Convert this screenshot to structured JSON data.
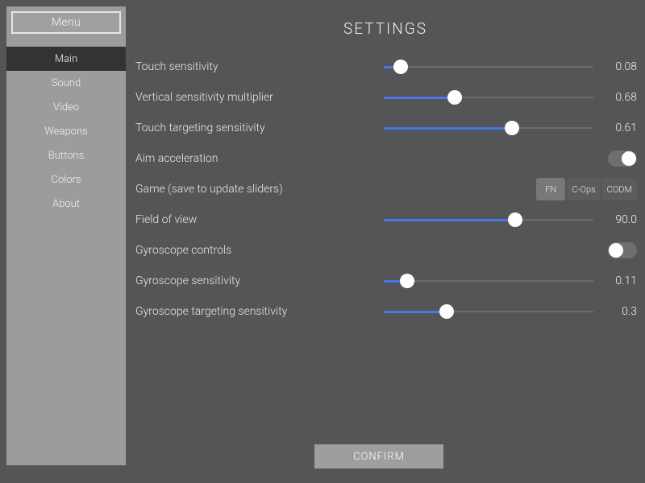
{
  "header": {
    "title": "SETTINGS"
  },
  "menu_button": "Menu",
  "nav": {
    "items": [
      {
        "label": "Main",
        "active": true
      },
      {
        "label": "Sound",
        "active": false
      },
      {
        "label": "Video",
        "active": false
      },
      {
        "label": "Weapons",
        "active": false
      },
      {
        "label": "Buttons",
        "active": false
      },
      {
        "label": "Colors",
        "active": false
      },
      {
        "label": "About",
        "active": false
      }
    ]
  },
  "settings": [
    {
      "kind": "slider",
      "label": "Touch sensitivity",
      "value": 0.08,
      "display": "0.08",
      "min": 0,
      "max": 1
    },
    {
      "kind": "slider",
      "label": "Vertical sensitivity multiplier",
      "value": 0.68,
      "display": "0.68",
      "min": 0,
      "max": 2
    },
    {
      "kind": "slider",
      "label": "Touch targeting sensitivity",
      "value": 0.61,
      "display": "0.61",
      "min": 0,
      "max": 1
    },
    {
      "kind": "toggle",
      "label": "Aim acceleration",
      "on": true
    },
    {
      "kind": "segment",
      "label": "Game (save to update sliders)",
      "options": [
        "FN",
        "C-Ops",
        "CODM"
      ],
      "selected": "FN"
    },
    {
      "kind": "slider",
      "label": "Field of view",
      "value": 90.0,
      "display": "90.0",
      "min": 40,
      "max": 120
    },
    {
      "kind": "toggle",
      "label": "Gyroscope controls",
      "on": false
    },
    {
      "kind": "slider",
      "label": "Gyroscope sensitivity",
      "value": 0.11,
      "display": "0.11",
      "min": 0,
      "max": 1
    },
    {
      "kind": "slider",
      "label": "Gyroscope targeting sensitivity",
      "value": 0.3,
      "display": "0.3",
      "min": 0,
      "max": 1
    }
  ],
  "confirm_label": "CONFIRM",
  "colors": {
    "accent": "#4a76e8"
  }
}
